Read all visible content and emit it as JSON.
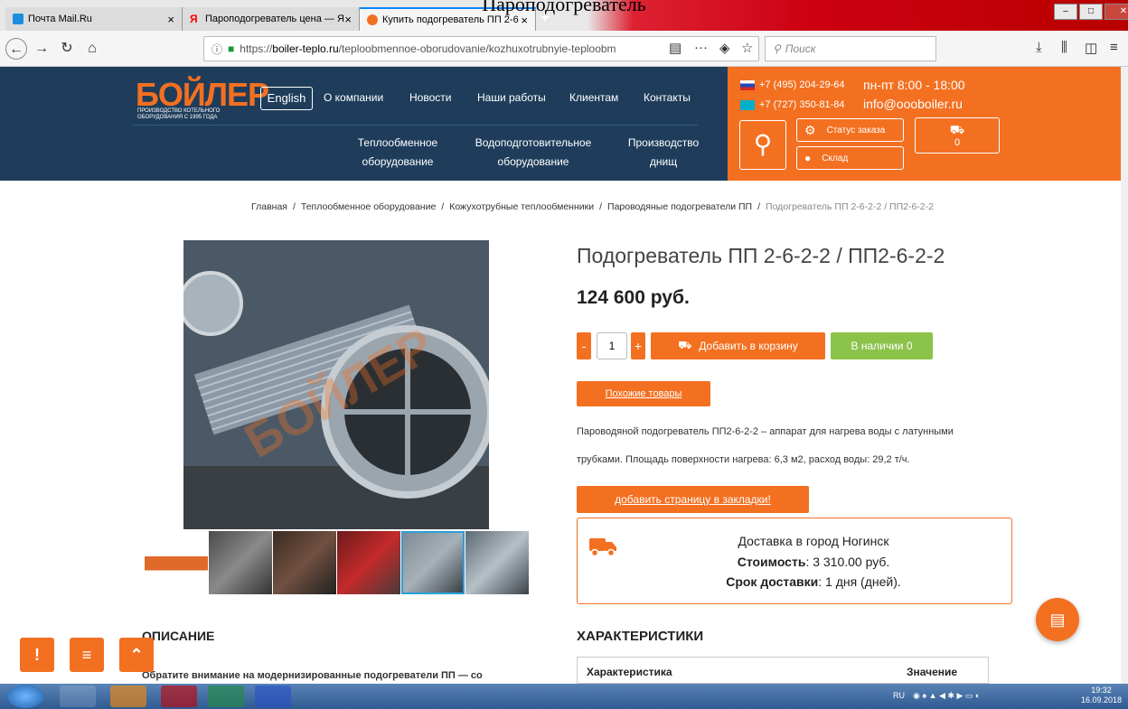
{
  "caption": "Пароподогреватель",
  "browser": {
    "tabs": [
      {
        "title": "Почта Mail.Ru",
        "close": "×"
      },
      {
        "title": "Пароподогреватель цена — Я",
        "close": "×"
      },
      {
        "title": "Купить подогреватель ПП 2-6",
        "close": "×"
      }
    ],
    "new_tab": "+",
    "url_prefix": "https://",
    "url_host": "boiler-teplo.ru",
    "url_path": "/teploobmennoe-oborudovanie/kozhuxotrubnyie-teploobm",
    "search_placeholder": "Поиск"
  },
  "site": {
    "logo": "БОЙЛЕР",
    "logo_sub": "ПРОИЗВОДСТВО КОТЕЛЬНОГО ОБОРУДОВАНИЯ С 1995 ГОДА",
    "lang_button": "English",
    "menu": [
      "О компании",
      "Новости",
      "Наши работы",
      "Клиентам",
      "Контакты"
    ],
    "menu2": [
      {
        "line1": "Теплообменное",
        "line2": "оборудование"
      },
      {
        "line1": "Водоподготовительное",
        "line2": "оборудование"
      },
      {
        "line1": "Производство",
        "line2": "днищ"
      }
    ],
    "phone1": "+7 (495) 204-29-64",
    "phone2": "+7 (727) 350-81-84",
    "hours": "пн-пт 8:00 - 18:00",
    "email": "info@oooboiler.ru",
    "order_status": "Статус заказа",
    "warehouse": "Склад",
    "cart_count": "0"
  },
  "breadcrumb": [
    "Главная",
    "Теплообменное оборудование",
    "Кожухотрубные теплообменники",
    "Пароводяные подогреватели ПП",
    "Подогреватель ПП 2-6-2-2 / ПП2-6-2-2"
  ],
  "breadcrumb_sep": "/",
  "product": {
    "title": "Подогреватель ПП 2-6-2-2 / ПП2-6-2-2",
    "price": "124 600 руб.",
    "qty_minus": "-",
    "qty": "1",
    "qty_plus": "+",
    "add_to_cart": "Добавить в корзину",
    "in_stock": "В наличии 0",
    "similar": "Похожие товары",
    "desc1": "Пароводяной подогреватель ПП2-6-2-2 – аппарат для нагрева воды с латунными",
    "desc2": "трубками. Площадь поверхности нагрева: 6,3 м2, расход воды: 29,2 т/ч.",
    "bookmark": "добавить страницу в закладки!",
    "delivery_city": "Доставка в город Ногинск",
    "cost_label": "Стоимость",
    "cost_value": ": 3 310.00 руб.",
    "term_label": "Срок доставки",
    "term_value": ": 1 дня (дней)."
  },
  "sections": {
    "description": "ОПИСАНИЕ",
    "characteristics": "ХАРАКТЕРИСТИКИ",
    "desc_text": "Обратите внимание на модернизированные подогреватели ПП — со",
    "col1": "Характеристика",
    "col2": "Значение"
  },
  "fabs": {
    "alert": "!",
    "list": "≡",
    "up": "⌃"
  },
  "taskbar": {
    "lang": "RU",
    "time": "19:32",
    "date": "16.09.2018"
  },
  "colors": {
    "brand_orange": "#f37021",
    "header_blue": "#1f3d5b",
    "stock_green": "#8bc34a"
  }
}
